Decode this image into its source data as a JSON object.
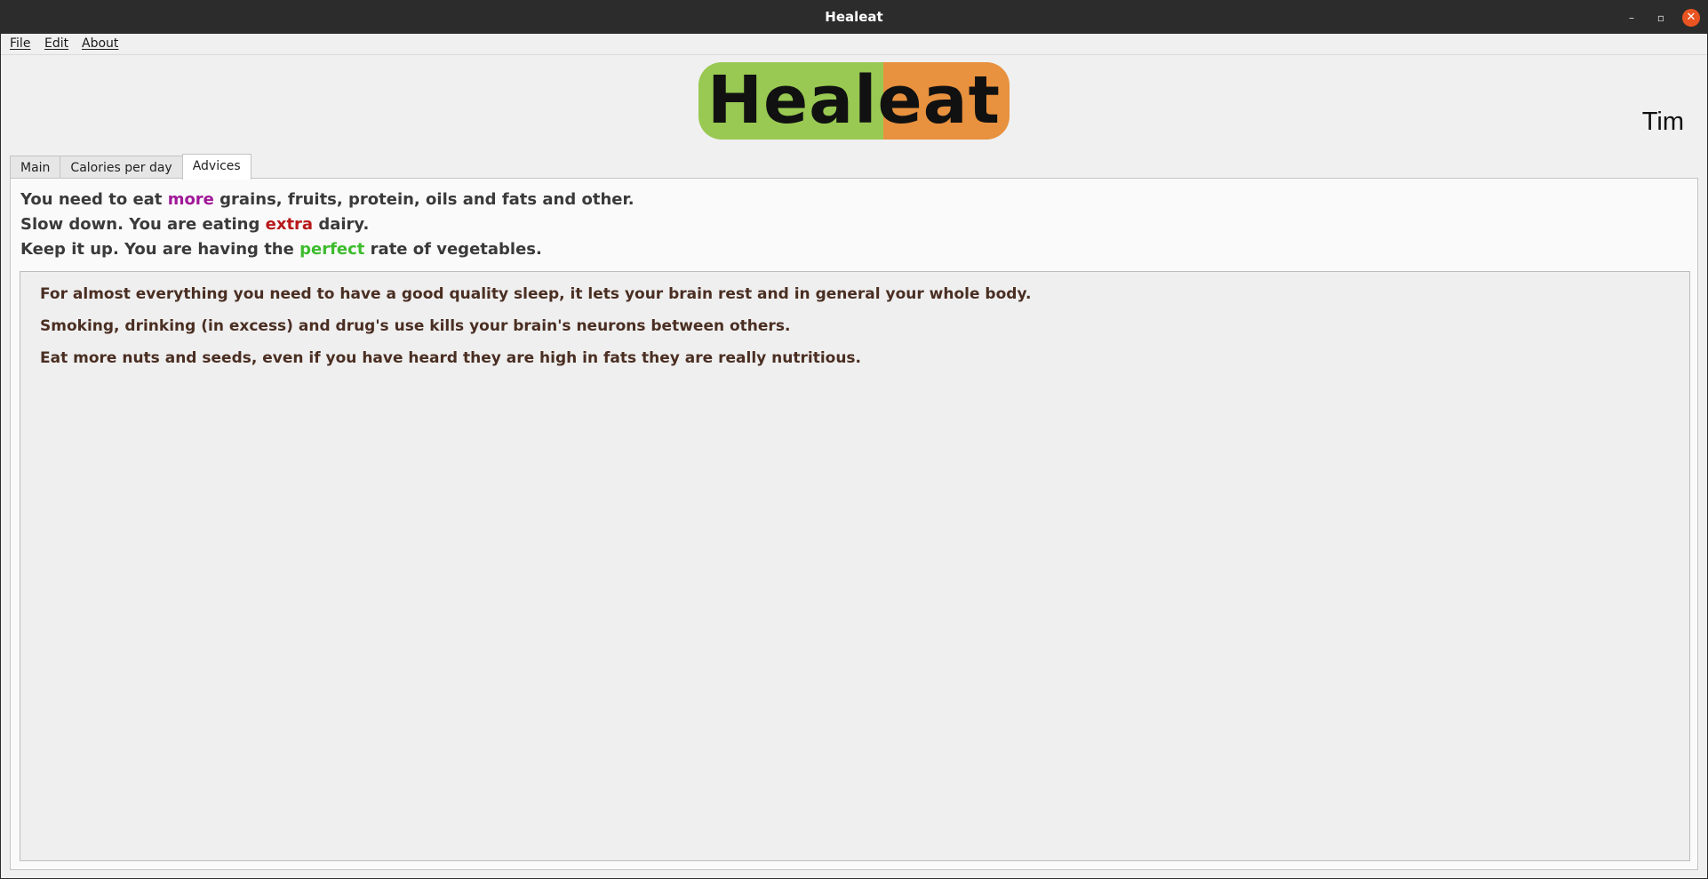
{
  "window": {
    "title": "Healeat",
    "controls": {
      "minimize": "–",
      "maximize": "▫",
      "close": "✕"
    }
  },
  "menu": [
    {
      "key": "F",
      "rest": "ile"
    },
    {
      "key": "E",
      "rest": "dit"
    },
    {
      "key": "A",
      "rest": "bout"
    }
  ],
  "logo": {
    "text": "Healeat",
    "colors": {
      "left": "#99c952",
      "right": "#e8913e"
    }
  },
  "user": {
    "name": "Tim"
  },
  "tabs": [
    {
      "label": "Main",
      "active": false
    },
    {
      "label": "Calories per day",
      "active": false
    },
    {
      "label": "Advices",
      "active": true
    }
  ],
  "status_lines": [
    {
      "before": "You need to eat ",
      "highlight": "more",
      "after": " grains, fruits, protein, oils and fats and other.",
      "color": "#a01898"
    },
    {
      "before": "Slow down. You are eating ",
      "highlight": "extra",
      "after": " dairy.",
      "color": "#b8181a"
    },
    {
      "before": "Keep it up. You are having the ",
      "highlight": "perfect",
      "after": " rate of vegetables.",
      "color": "#3cbc2c"
    }
  ],
  "advices": [
    "For almost everything you need to have a good quality sleep, it lets your brain rest and in general your whole body.",
    "Smoking, drinking (in excess) and drug's use kills your brain's neurons between others.",
    "Eat more nuts and seeds, even if you have heard they are high in fats they are really nutritious."
  ]
}
